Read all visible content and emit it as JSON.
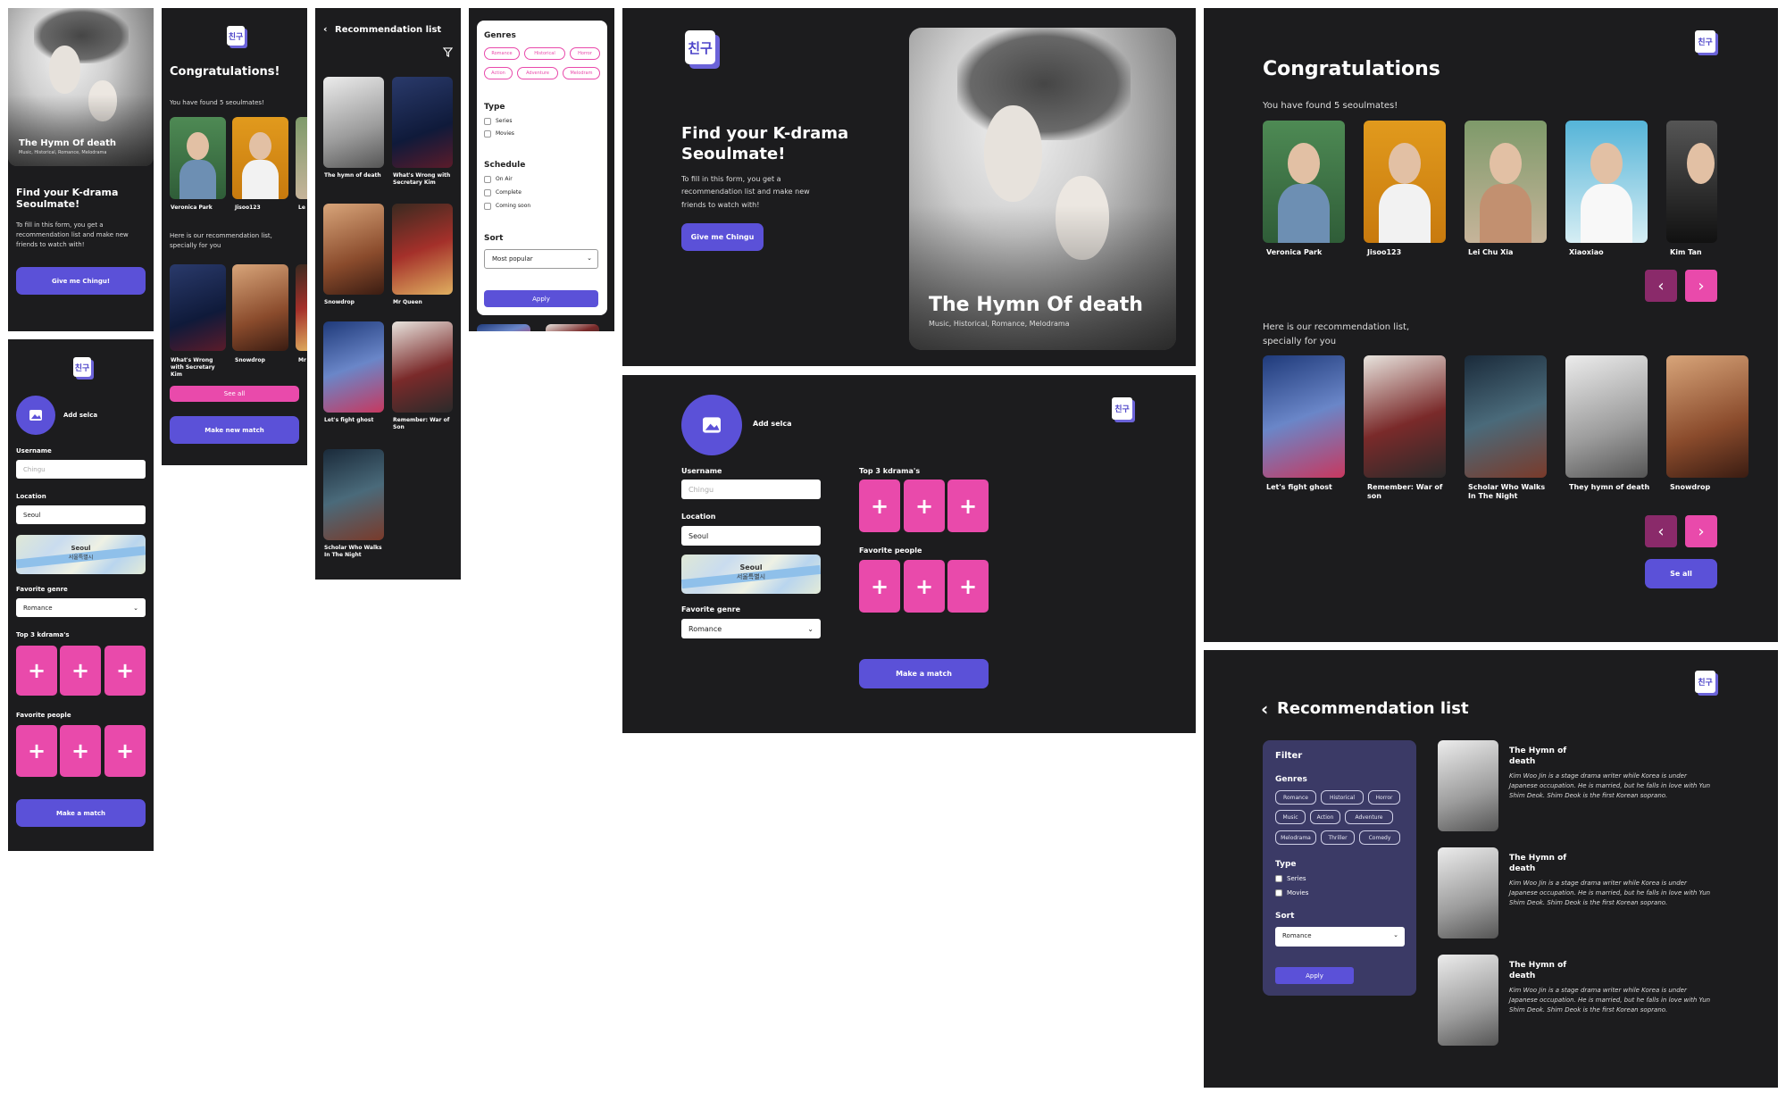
{
  "brand": {
    "logo": "친구"
  },
  "hero": {
    "title": "The Hymn Of death",
    "title_small": "The Hymn Of death",
    "genres": "Music, Historical, Romance, Melodrama"
  },
  "intro": {
    "title": "Find your K-drama Seoulmate!",
    "desc": "To fill in this form, you get a recommendation list and make new friends to watch with!",
    "cta_mobile": "Give me Chingu!",
    "cta_desktop": "Give me Chingu"
  },
  "form": {
    "add_selca": "Add selca",
    "username_label": "Username",
    "username_placeholder": "Chingu",
    "location_label": "Location",
    "location_value": "Seoul",
    "map_label": "Seoul",
    "map_sub": "서울특별시",
    "genre_label": "Favorite genre",
    "genre_value": "Romance",
    "top3_label_mobile": "Top 3 kdrama's",
    "top3_label_desktop": "Top 3 kdrama's",
    "people_label": "Favorite people",
    "make_match_mobile": "Make a match",
    "make_match_desktop": "Make a match",
    "plus": "+"
  },
  "congrats": {
    "title_mobile": "Congratulations!",
    "title_desktop": "Congratulations",
    "found": "You have found 5 seoulmates!",
    "rec_intro": "Here is our recommendation list, specially for you",
    "see_all_mobile": "See all",
    "see_all_desktop": "Se all",
    "new_match": "Make new match",
    "people": [
      "Veronica Park",
      "Jisoo123",
      "Lei Chu Xia",
      "Xiaoxiao",
      "Kim Tan"
    ],
    "shows": [
      "Let's fight ghost",
      "Remember: War of son",
      "Scholar Who Walks In The Night",
      "They hymn of death",
      "Snowdrop"
    ],
    "mobile_shows": [
      "What's Wrong with Secretary Kim",
      "Snowdrop",
      "Mr"
    ]
  },
  "reclist": {
    "title": "Recommendation list",
    "items": [
      "The hymn of death",
      "What's Wrong with Secretary Kim",
      "Snowdrop",
      "Mr Queen",
      "Let's fight ghost",
      "Remember: War of Son",
      "Scholar Who Walks In The Night"
    ]
  },
  "filter": {
    "title": "Filter",
    "genres_label": "Genres",
    "type_label": "Type",
    "schedule_label": "Schedule",
    "sort_label": "Sort",
    "genres_mobile": [
      "Romance",
      "Historical",
      "Horror",
      "Action",
      "Adventure",
      "Melodram"
    ],
    "genres": [
      "Romance",
      "Historical",
      "Horror",
      "Music",
      "Action",
      "Adventure",
      "Melodrama",
      "Thriller",
      "Comedy"
    ],
    "types": [
      "Series",
      "Movies"
    ],
    "schedule": [
      "On Air",
      "Complete",
      "Coming soon"
    ],
    "sort_mobile": "Most popular",
    "sort_desktop": "Romance",
    "apply": "Apply"
  },
  "desk_rec": {
    "item_title": "The Hymn of death",
    "item_desc": "Kim Woo Jin is a stage drama writer while Korea is under Japanese occupation. He is married, but he falls in love with Yun Shim Deok. Shim Deok is the first Korean soprano."
  },
  "colors": {
    "bg": "#1c1c1e",
    "accent": "#5b51d8",
    "pink": "#e94aab",
    "filter": "#3b3a66"
  }
}
